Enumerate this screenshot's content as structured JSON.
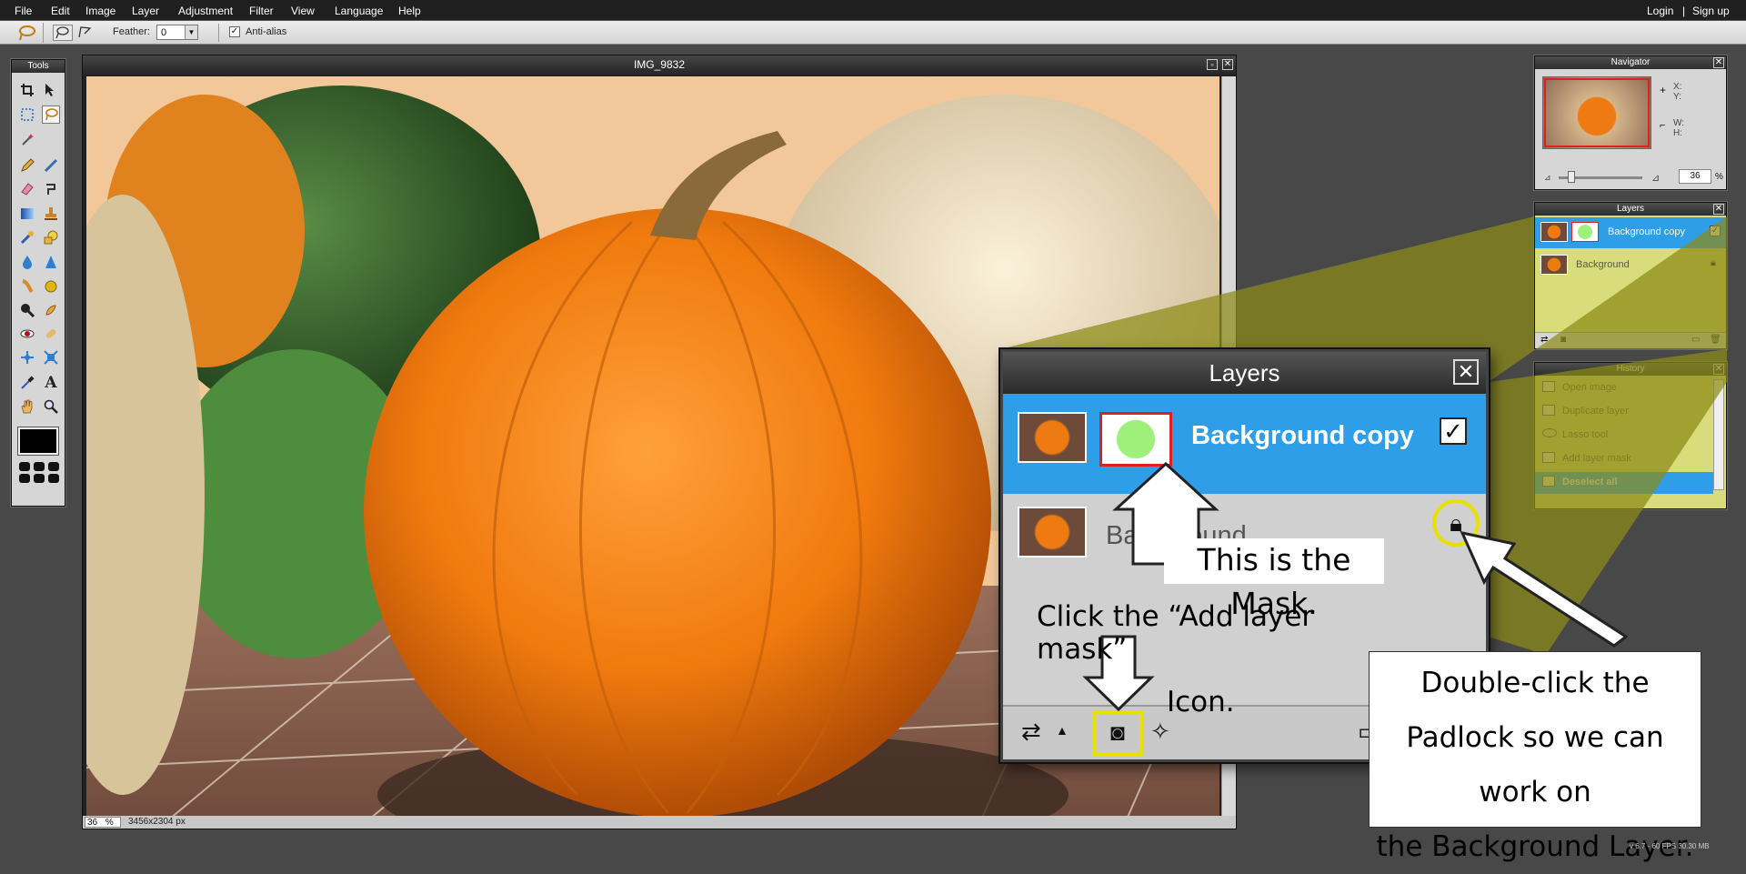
{
  "menu": {
    "items": [
      "File",
      "Edit",
      "Image",
      "Layer",
      "Adjustment",
      "Filter",
      "View",
      "Language",
      "Help"
    ],
    "login": "Login",
    "separator": "|",
    "signup": "Sign up"
  },
  "options_bar": {
    "feather_label": "Feather:",
    "feather_value": "0",
    "antialias_label": "Anti-alias"
  },
  "tools_panel": {
    "title": "Tools"
  },
  "document": {
    "title": "IMG_9832",
    "zoom": "36",
    "zoom_unit": "%",
    "size": "3456x2304 px"
  },
  "navigator": {
    "title": "Navigator",
    "x_label": "X:",
    "y_label": "Y:",
    "w_label": "W:",
    "h_label": "H:",
    "zoom_value": "36",
    "zoom_unit": "%"
  },
  "layers_panel": {
    "title": "Layers",
    "layers": [
      {
        "name": "Background copy",
        "selected": true
      },
      {
        "name": "Background",
        "selected": false
      }
    ]
  },
  "history_panel": {
    "title": "History",
    "items": [
      "Open image",
      "Duplicate layer",
      "Lasso tool",
      "Add layer mask",
      "Deselect all"
    ]
  },
  "zoomed_layers": {
    "title": "Layers",
    "layer1": "Background copy",
    "layer2": "Background"
  },
  "annotations": {
    "mask": "This is the Mask.",
    "add_mask_line1": "Click the “Add layer mask”",
    "add_mask_line2": "Icon.",
    "padlock_line1": "Double-click the",
    "padlock_line2": "Padlock so we can work on",
    "padlock_line3": "the Background Layer."
  },
  "footer": {
    "version": "v 6.7 - 60 FPS 30.30 MB"
  },
  "colors": {
    "selected_blue": "#2e9ee8",
    "highlight_yellow": "#c8c300",
    "callout_olive": "#8c8a16"
  }
}
